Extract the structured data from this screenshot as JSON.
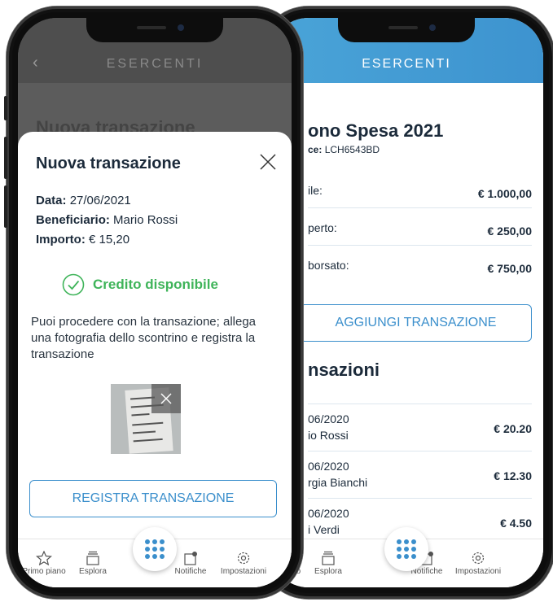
{
  "colors": {
    "accent": "#3b8fcc",
    "success": "#3fb45a",
    "header_blue": "#4aa4d8"
  },
  "right_screen": {
    "header_title": "ESERCENTI",
    "page_title": "ono Spesa 2021",
    "code_label": "ce:",
    "code_value": "LCH6543BD",
    "rows": [
      {
        "label": "ile:",
        "value": "€ 1.000,00"
      },
      {
        "label": "perto:",
        "value": "€ 250,00"
      },
      {
        "label": "borsato:",
        "value": "€ 750,00"
      }
    ],
    "add_button": "AGGIUNGI TRANSAZIONE",
    "section_title": "nsazioni",
    "transactions": [
      {
        "date": "06/2020",
        "name": "io Rossi",
        "amount": "€ 20.20"
      },
      {
        "date": "06/2020",
        "name": "rgia Bianchi",
        "amount": "€ 12.30"
      },
      {
        "date": "06/2020",
        "name": "i Verdi",
        "amount": "€ 4.50"
      }
    ]
  },
  "left_screen": {
    "header_title": "ESERCENTI",
    "background_title": "Nuova transazione",
    "modal": {
      "title": "Nuova transazione",
      "date_label": "Data:",
      "date_value": "27/06/2021",
      "beneficiary_label": "Beneficiario:",
      "beneficiary_value": "Mario Rossi",
      "amount_label": "Importo:",
      "amount_value": "€ 15,20",
      "credit_status": "Credito disponibile",
      "description": "Puoi procedere con la transazione; allega una fotografia dello scontrino e registra la transazione",
      "register_button": "REGISTRA TRANSAZIONE"
    }
  },
  "tabbar": {
    "left": [
      "Primo piano",
      "Esplora",
      "Notifiche",
      "Impostazioni"
    ],
    "right": [
      "piano",
      "Esplora",
      "Notifiche",
      "Impostazioni"
    ]
  }
}
